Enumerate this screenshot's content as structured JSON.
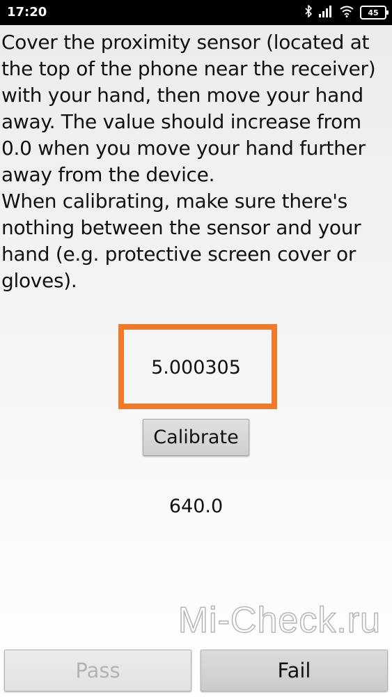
{
  "status_bar": {
    "time": "17:20",
    "battery_level": "45",
    "icons": [
      "bluetooth-icon",
      "signal-icon",
      "wifi-icon",
      "battery-icon"
    ]
  },
  "instructions": {
    "text": "Cover the proximity sensor (located at the top of the phone near the receiver) with your hand, then move your hand away. The value should increase from 0.0 when you move your hand further away from the device.\nWhen calibrating, make sure there's nothing between the sensor and your hand (e.g. protective screen cover or gloves)."
  },
  "sensor": {
    "current_value": "5.000305",
    "max_value": "640.0",
    "highlight_color": "#f07a2a"
  },
  "buttons": {
    "calibrate": "Calibrate",
    "pass": "Pass",
    "fail": "Fail"
  },
  "watermark": {
    "text": "Mi-Check.ru"
  }
}
